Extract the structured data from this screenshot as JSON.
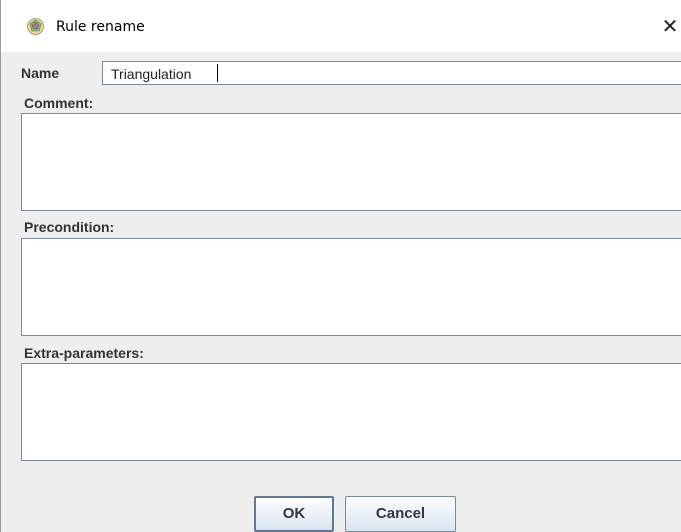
{
  "window": {
    "title": "Rule rename",
    "close_icon": "close-icon",
    "app_icon": "app-logo-icon"
  },
  "form": {
    "name_label": "Name",
    "name_value": "Triangulation",
    "comment_label": "Comment:",
    "comment_value": "",
    "precondition_label": "Precondition:",
    "precondition_value": "",
    "extra_parameters_label": "Extra-parameters:",
    "extra_parameters_value": ""
  },
  "buttons": {
    "ok_label": "OK",
    "cancel_label": "Cancel"
  },
  "colors": {
    "window_background": "#eeeeee",
    "title_bar": "#ffffff",
    "field_border": "#7a8a99",
    "button_gradient_top": "#fdfeff",
    "button_gradient_bottom": "#d9e4ef"
  }
}
